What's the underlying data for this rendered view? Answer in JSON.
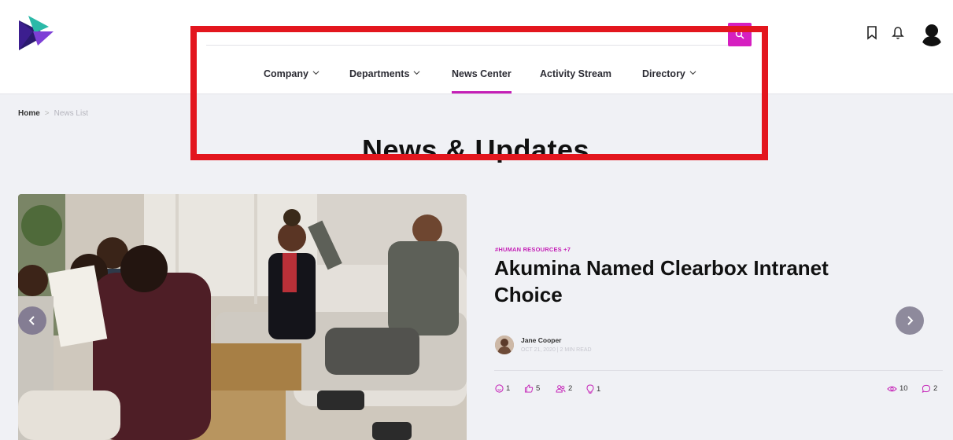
{
  "header": {
    "nav": [
      {
        "label": "Company",
        "has_dropdown": true
      },
      {
        "label": "Departments",
        "has_dropdown": true
      },
      {
        "label": "News Center",
        "has_dropdown": false,
        "active": true
      },
      {
        "label": "Activity Stream",
        "has_dropdown": false
      },
      {
        "label": "Directory",
        "has_dropdown": true
      }
    ],
    "icons": [
      "logo",
      "search-icon",
      "bookmark-icon",
      "bell-icon",
      "user-avatar"
    ]
  },
  "breadcrumb": {
    "home": "Home",
    "separator": ">",
    "current": "News List"
  },
  "page": {
    "title": "News & Updates"
  },
  "article": {
    "tag": "#HUMAN RESOURCES +7",
    "title": "Akumina Named Clearbox Intranet Choice",
    "author": "Jane Cooper",
    "meta": "OCT 21, 2020 | 2 MIN READ",
    "stats": {
      "smile": "1",
      "likes": "5",
      "team": "2",
      "ideas": "1",
      "views": "10",
      "comments": "2"
    }
  },
  "colors": {
    "accent": "#c41fb6",
    "annotation": "#e3161e",
    "background": "#f0f1f5"
  }
}
